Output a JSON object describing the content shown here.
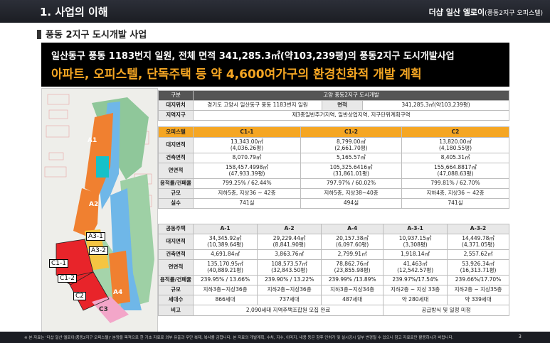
{
  "header": {
    "section": "1. 사업의 이해",
    "brand": "더샵 일산 엘로이",
    "brand_sub": "(풍동2지구 오피스텔)"
  },
  "subtitle": "풍동 2지구 도시개발 사업",
  "banner": {
    "line1": "일산동구 풍동 1183번지 일원, 전체 면적 341,285.3㎡(약103,239평)의 풍동2지구 도시개발사업",
    "line2": "아파트, 오피스텔, 단독주택 등 약 4,600여가구의 환경친화적 개발 계획"
  },
  "map": {
    "labels": [
      "A1",
      "A2",
      "A3-1",
      "A3-2",
      "A4",
      "C1-1",
      "C1-2",
      "C2",
      "C3"
    ]
  },
  "overview": {
    "h_label": "구분",
    "h_value": "고양 풍동2지구 도시개발",
    "loc_label": "대지위치",
    "loc_value": "경기도 고양시 일산동구 풍동 1183번지 일원",
    "area_label": "면적",
    "area_value": "341,285.3㎡(약103,239평)",
    "zone_label": "지역지구",
    "zone_value": "제3종일반주거지역, 일반상업지역, 지구단위계획구역"
  },
  "officetel": {
    "head": "오피스텔",
    "cols": [
      "C1-1",
      "C1-2",
      "C2"
    ],
    "rows": [
      {
        "label": "대지면적",
        "v": [
          "13,343.00㎡\n(4,036.26평)",
          "8,799.00㎡\n(2,661.70평)",
          "13,820.00㎡\n(4,180.55평)"
        ]
      },
      {
        "label": "건축면적",
        "v": [
          "8,070.79㎡",
          "5,165.57㎡",
          "8,405.31㎡"
        ]
      },
      {
        "label": "연면적",
        "v": [
          "158,457.4998㎡\n(47,933.39평)",
          "105,325.6416㎡\n(31,861.01평)",
          "155,664.8817㎡\n(47,088.63평)"
        ]
      },
      {
        "label": "용적률/건폐율",
        "v": [
          "799.25% / 62.44%",
          "797.97% / 60.02%",
          "799.81% / 62.70%"
        ]
      },
      {
        "label": "규모",
        "v": [
          "지하5층, 지상36 ~ 42층",
          "지하5층, 지상38~40층",
          "지하4층, 지상36 ~ 42층"
        ]
      },
      {
        "label": "실수",
        "v": [
          "741실",
          "494실",
          "741실"
        ]
      }
    ]
  },
  "apartment": {
    "head": "공동주택",
    "cols": [
      "A-1",
      "A-2",
      "A-4",
      "A-3-1",
      "A-3-2"
    ],
    "rows": [
      {
        "label": "대지면적",
        "v": [
          "34,345.92㎡\n(10,389.64평)",
          "29,229.44㎡\n(8,841.90평)",
          "20,157.38㎡\n(6,097.60평)",
          "10,937.15㎡\n(3,308평)",
          "14,449.78㎡\n(4,371.05평)"
        ]
      },
      {
        "label": "건축면적",
        "v": [
          "4,691.84㎡",
          "3,863.76㎡",
          "2,799.91㎡",
          "1,918.14㎡",
          "2,557.62㎡"
        ]
      },
      {
        "label": "연면적",
        "v": [
          "135,170.95㎡\n(40,889.21평)",
          "108,573.57㎡\n(32,843.50평)",
          "78,862.76㎡\n(23,855.98평)",
          "41,463㎡\n(12,542.57평)",
          "53,926.34㎡\n(16,313.71평)"
        ]
      },
      {
        "label": "용적률/건폐율",
        "v": [
          "239.95% / 13.66%",
          "239.90% / 13.22%",
          "239.99% /13.89%",
          "239.97%/17.54%",
          "239.66%/17.70%"
        ]
      },
      {
        "label": "규모",
        "v": [
          "지하3층~지상36층",
          "지하2층~지상36층",
          "지하3층~지상34층",
          "지하2층 ~ 지상 33층",
          "지하2층 ~ 지상35층"
        ]
      },
      {
        "label": "세대수",
        "v": [
          "866세대",
          "737세대",
          "487세대",
          "약 280세대",
          "약 339세대"
        ]
      }
    ],
    "note_label": "비고",
    "note_left": "2,090세대 지역주택조합원 모집 완료",
    "note_right": "공급방식 및 일정 미정"
  },
  "footer": {
    "note": "※ 본 자료는 '더샵 일산 엘로이(풍동2지구 오피스텔)' 분양을 목적으로 한 기초 자료로 외부 유출과 무단 복제, 복사를 금합니다. 본 자료의 개발계획, 수치, 지수, 이미지, 내용 등은 향후 인허가 및 실시공시 일부 변경될 수 있으니 참고 자료로만 활용하시기 바랍니다.",
    "page": "3"
  }
}
